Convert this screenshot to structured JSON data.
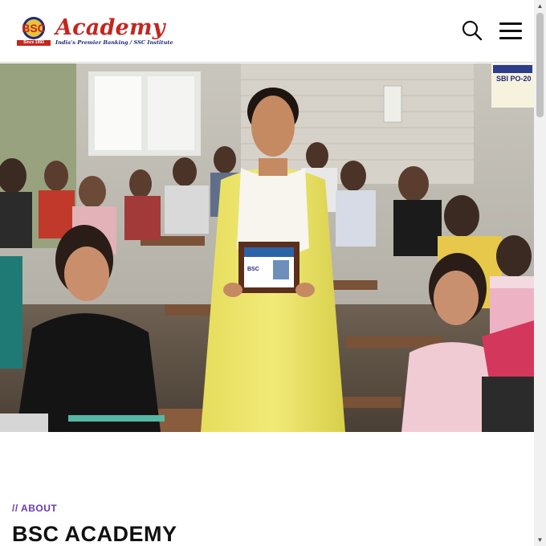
{
  "header": {
    "logo_word": "Academy",
    "logo_tagline": "India's Premier Banking / SSC Institute",
    "logo_badge_text": "BSC",
    "logo_since": "Since 1993",
    "search_icon": "search-icon",
    "menu_icon": "hamburger-menu-icon"
  },
  "hero": {
    "image": "classroom-students-photo",
    "plaque_text": "BSC",
    "board_text": "SBI PO-20"
  },
  "about": {
    "kicker": "// ABOUT",
    "title": "BSC ACADEMY"
  },
  "colors": {
    "brand_red": "#c5261e",
    "brand_navy": "#1e2a78",
    "accent_purple": "#6a3ab2",
    "text_dark": "#111111"
  },
  "scrollbar": {
    "up_icon": "scroll-up-arrow-icon",
    "down_icon": "scroll-down-arrow-icon"
  }
}
